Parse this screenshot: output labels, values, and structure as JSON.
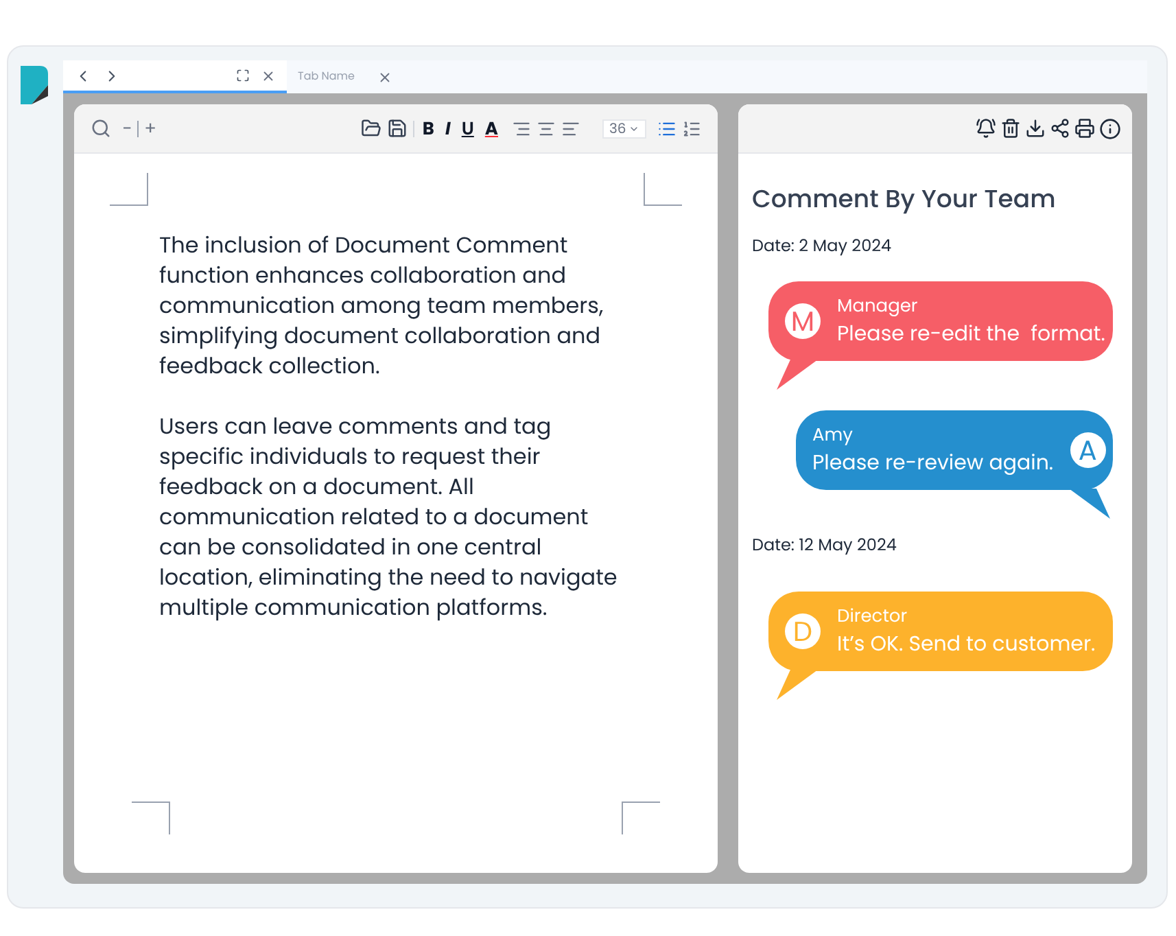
{
  "tabs": [
    {
      "selected": true
    },
    {
      "label": "Tab Name",
      "selected": false
    }
  ],
  "editor": {
    "zoom_out": "−",
    "zoom_in": "+",
    "format_buttons": [
      {
        "label": "B",
        "kind": "bold"
      },
      {
        "label": "I",
        "kind": "italic"
      },
      {
        "label": "U",
        "kind": "underline"
      },
      {
        "label": "A",
        "kind": "color"
      }
    ],
    "font_size": "36",
    "paragraphs": [
      "The inclusion of Document Comment function enhances collaboration and communication among team members, simplifying document collaboration and feedback collection.",
      "Users can leave comments and tag specific individuals to request their feedback on a document. All communication related to a document can be consolidated in one central location, eliminating the need to navigate multiple communication platforms."
    ]
  },
  "comments": {
    "title": "Comment By Your Team",
    "items": [
      {
        "kind": "date",
        "text": "Date: 2 May 2024"
      },
      {
        "kind": "incoming",
        "color": "#f65e67",
        "initial": "M",
        "author": "Manager",
        "text": "Please re-edit the  format."
      },
      {
        "kind": "outgoing",
        "color": "#258fce",
        "initial": "A",
        "author": "Amy",
        "text": "Please re-review again."
      },
      {
        "kind": "date",
        "text": "Date: 12 May 2024"
      },
      {
        "kind": "incoming",
        "color": "#fdb22c",
        "initial": "D",
        "author": "Director",
        "text": "It’s OK. Send to customer."
      }
    ]
  }
}
